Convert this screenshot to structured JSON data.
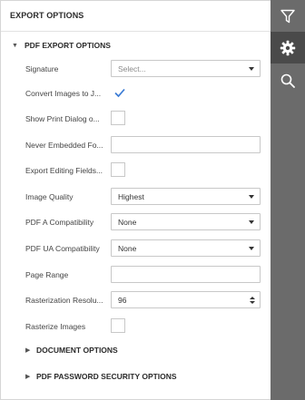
{
  "panel": {
    "title": "EXPORT OPTIONS"
  },
  "pdf_group": {
    "title": "PDF EXPORT OPTIONS",
    "expanded": true,
    "fields": {
      "signature": {
        "label": "Signature",
        "placeholder": "Select..."
      },
      "convert_images": {
        "label": "Convert Images to J...",
        "checked": true
      },
      "show_print_dialog": {
        "label": "Show Print Dialog o...",
        "checked": false
      },
      "never_embedded": {
        "label": "Never Embedded Fo...",
        "value": ""
      },
      "export_editing": {
        "label": "Export Editing Fields...",
        "checked": false
      },
      "image_quality": {
        "label": "Image Quality",
        "value": "Highest"
      },
      "pdfa": {
        "label": "PDF A Compatibility",
        "value": "None"
      },
      "pdfua": {
        "label": "PDF UA Compatibility",
        "value": "None"
      },
      "page_range": {
        "label": "Page Range",
        "value": ""
      },
      "rasterization": {
        "label": "Rasterization Resolu...",
        "value": "96"
      },
      "rasterize_images": {
        "label": "Rasterize Images",
        "checked": false
      }
    }
  },
  "document_group": {
    "title": "DOCUMENT OPTIONS",
    "expanded": false
  },
  "password_group": {
    "title": "PDF PASSWORD SECURITY OPTIONS",
    "expanded": false
  },
  "sidebar": {
    "buttons": [
      {
        "icon": "filter-icon",
        "active": false
      },
      {
        "icon": "gear-icon",
        "active": true
      },
      {
        "icon": "search-icon",
        "active": false
      }
    ]
  },
  "colors": {
    "sidebar": "#6b6b6b",
    "sidebar_active": "#4a4a4a",
    "accent": "#3a7bd5"
  }
}
